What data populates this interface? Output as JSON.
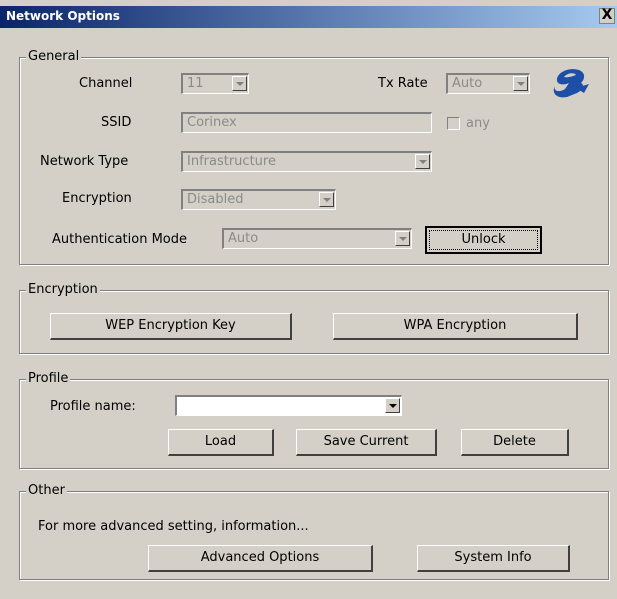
{
  "window": {
    "title": "Network Options",
    "close_label": "X"
  },
  "general": {
    "legend": "General",
    "channel": {
      "label": "Channel",
      "value": "11"
    },
    "tx_rate": {
      "label": "Tx Rate",
      "value": "Auto"
    },
    "ssid": {
      "label": "SSID",
      "value": "Corinex",
      "any_label": "any"
    },
    "network_type": {
      "label": "Network Type",
      "value": "Infrastructure"
    },
    "encryption": {
      "label": "Encryption",
      "value": "Disabled"
    },
    "auth_mode": {
      "label": "Authentication Mode",
      "value": "Auto"
    },
    "unlock_label": "Unlock"
  },
  "encryption_group": {
    "legend": "Encryption",
    "wep_label": "WEP Encryption Key",
    "wpa_label": "WPA Encryption"
  },
  "profile": {
    "legend": "Profile",
    "name_label": "Profile name:",
    "name_value": "",
    "load_label": "Load",
    "save_label": "Save Current",
    "delete_label": "Delete"
  },
  "other": {
    "legend": "Other",
    "info_text": "For more advanced setting, information...",
    "advanced_label": "Advanced Options",
    "system_info_label": "System Info"
  },
  "colors": {
    "titlebar_start": "#0a246a",
    "titlebar_end": "#a6caf0",
    "dialog_bg": "#d4d0c8",
    "logo_blue": "#1e4fa8"
  }
}
